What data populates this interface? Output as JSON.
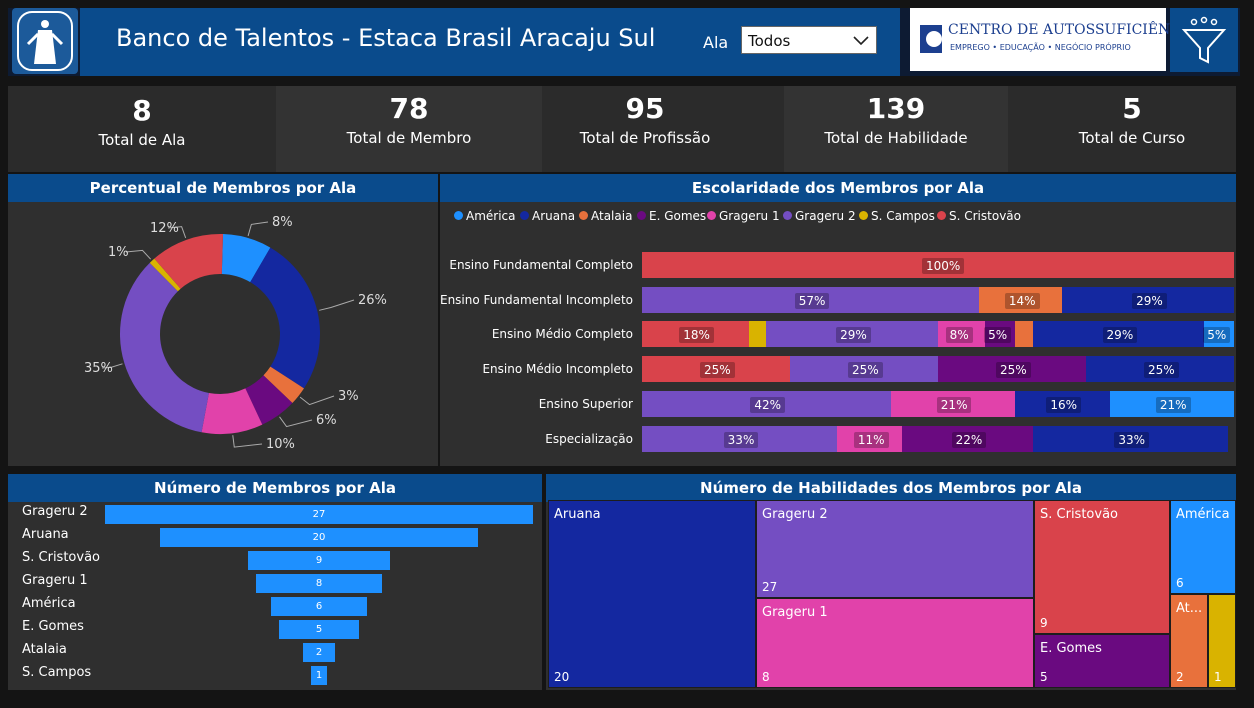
{
  "header": {
    "title": "Banco de Talentos - Estaca Brasil Aracaju Sul",
    "filter_label": "Ala",
    "filter_value": "Todos",
    "partner_logo_line1": "CENTRO DE AUTOSSUFICIÊNCIA",
    "partner_logo_line2": "EMPREGO • EDUCAÇÃO • NEGÓCIO PRÓPRIO"
  },
  "kpis": [
    {
      "value": "8",
      "label": "Total de Ala"
    },
    {
      "value": "78",
      "label": "Total de Membro"
    },
    {
      "value": "95",
      "label": "Total de Profissão"
    },
    {
      "value": "139",
      "label": "Total de Habilidade"
    },
    {
      "value": "5",
      "label": "Total de Curso"
    }
  ],
  "colors": {
    "America": "#1e90ff",
    "Aruana": "#1428a0",
    "Atalaia": "#e8713c",
    "E. Gomes": "#6a0a80",
    "Grageru 1": "#e142aa",
    "Grageru 2": "#744ec2",
    "S. Campos": "#d9b300",
    "S. Cristovao": "#d9434b"
  },
  "donut": {
    "title": "Percentual de Membros por Ala",
    "labels": [
      "8%",
      "26%",
      "3%",
      "6%",
      "10%",
      "35%",
      "1%",
      "12%"
    ]
  },
  "stacked": {
    "title": "Escolaridade dos Membros por Ala",
    "legend": [
      "América",
      "Aruana",
      "Atalaia",
      "E. Gomes",
      "Grageru 1",
      "Grageru 2",
      "S. Campos",
      "S. Cristovão"
    ],
    "categories": [
      "Ensino Fundamental Completo",
      "Ensino Fundamental Incompleto",
      "Ensino Médio Completo",
      "Ensino Médio Incompleto",
      "Ensino Superior",
      "Especialização"
    ]
  },
  "funnel": {
    "title": "Número de Membros por Ala",
    "items": [
      {
        "name": "Grageru 2",
        "value": "27"
      },
      {
        "name": "Aruana",
        "value": "20"
      },
      {
        "name": "S. Cristovão",
        "value": "9"
      },
      {
        "name": "Grageru 1",
        "value": "8"
      },
      {
        "name": "América",
        "value": "6"
      },
      {
        "name": "E. Gomes",
        "value": "5"
      },
      {
        "name": "Atalaia",
        "value": "2"
      },
      {
        "name": "S. Campos",
        "value": "1"
      }
    ]
  },
  "treemap": {
    "title": "Número de Habilidades dos Membros por Ala",
    "cells": [
      {
        "name": "Aruana",
        "value": "20"
      },
      {
        "name": "Grageru 2",
        "value": "27"
      },
      {
        "name": "Grageru 1",
        "value": "8"
      },
      {
        "name": "S. Cristovão",
        "value": "9"
      },
      {
        "name": "E. Gomes",
        "value": "5"
      },
      {
        "name": "América",
        "value": "6"
      },
      {
        "name": "At...",
        "value": "2"
      },
      {
        "name": "",
        "value": "1"
      }
    ]
  },
  "chart_data": [
    {
      "type": "pie",
      "title": "Percentual de Membros por Ala",
      "categories": [
        "América",
        "Aruana",
        "Atalaia",
        "E. Gomes",
        "Grageru 1",
        "Grageru 2",
        "S. Campos",
        "S. Cristovão"
      ],
      "values": [
        8,
        26,
        3,
        6,
        10,
        35,
        1,
        12
      ]
    },
    {
      "type": "bar",
      "title": "Escolaridade dos Membros por Ala",
      "stacked": true,
      "categories": [
        "Ensino Fundamental Completo",
        "Ensino Fundamental Incompleto",
        "Ensino Médio Completo",
        "Ensino Médio Incompleto",
        "Ensino Superior",
        "Especialização"
      ],
      "rows": [
        [
          {
            "series": "S. Cristovão",
            "value": 100,
            "label": "100%"
          }
        ],
        [
          {
            "series": "Grageru 2",
            "value": 57,
            "label": "57%"
          },
          {
            "series": "Atalaia",
            "value": 14,
            "label": "14%"
          },
          {
            "series": "Aruana",
            "value": 29,
            "label": "29%"
          }
        ],
        [
          {
            "series": "S. Cristovão",
            "value": 18,
            "label": "18%"
          },
          {
            "series": "S. Campos",
            "value": 3,
            "label": ""
          },
          {
            "series": "Grageru 2",
            "value": 29,
            "label": "29%"
          },
          {
            "series": "Grageru 1",
            "value": 8,
            "label": "8%"
          },
          {
            "series": "E. Gomes",
            "value": 5,
            "label": "5%"
          },
          {
            "series": "Atalaia",
            "value": 3,
            "label": ""
          },
          {
            "series": "Aruana",
            "value": 29,
            "label": "29%"
          },
          {
            "series": "América",
            "value": 5,
            "label": "5%"
          }
        ],
        [
          {
            "series": "S. Cristovão",
            "value": 25,
            "label": "25%"
          },
          {
            "series": "Grageru 2",
            "value": 25,
            "label": "25%"
          },
          {
            "series": "E. Gomes",
            "value": 25,
            "label": "25%"
          },
          {
            "series": "Aruana",
            "value": 25,
            "label": "25%"
          }
        ],
        [
          {
            "series": "Grageru 2",
            "value": 42,
            "label": "42%"
          },
          {
            "series": "Grageru 1",
            "value": 21,
            "label": "21%"
          },
          {
            "series": "Aruana",
            "value": 16,
            "label": "16%"
          },
          {
            "series": "América",
            "value": 21,
            "label": "21%"
          }
        ],
        [
          {
            "series": "Grageru 2",
            "value": 33,
            "label": "33%"
          },
          {
            "series": "Grageru 1",
            "value": 11,
            "label": "11%"
          },
          {
            "series": "E. Gomes",
            "value": 22,
            "label": "22%"
          },
          {
            "series": "Aruana",
            "value": 33,
            "label": "33%"
          }
        ]
      ]
    },
    {
      "type": "bar",
      "title": "Número de Membros por Ala",
      "categories": [
        "Grageru 2",
        "Aruana",
        "S. Cristovão",
        "Grageru 1",
        "América",
        "E. Gomes",
        "Atalaia",
        "S. Campos"
      ],
      "values": [
        27,
        20,
        9,
        8,
        6,
        5,
        2,
        1
      ]
    },
    {
      "type": "heatmap",
      "title": "Número de Habilidades dos Membros por Ala",
      "categories": [
        "Aruana",
        "Grageru 2",
        "Grageru 1",
        "S. Cristovão",
        "E. Gomes",
        "América",
        "Atalaia",
        "S. Campos"
      ],
      "values": [
        20,
        27,
        8,
        9,
        5,
        6,
        2,
        1
      ]
    }
  ]
}
